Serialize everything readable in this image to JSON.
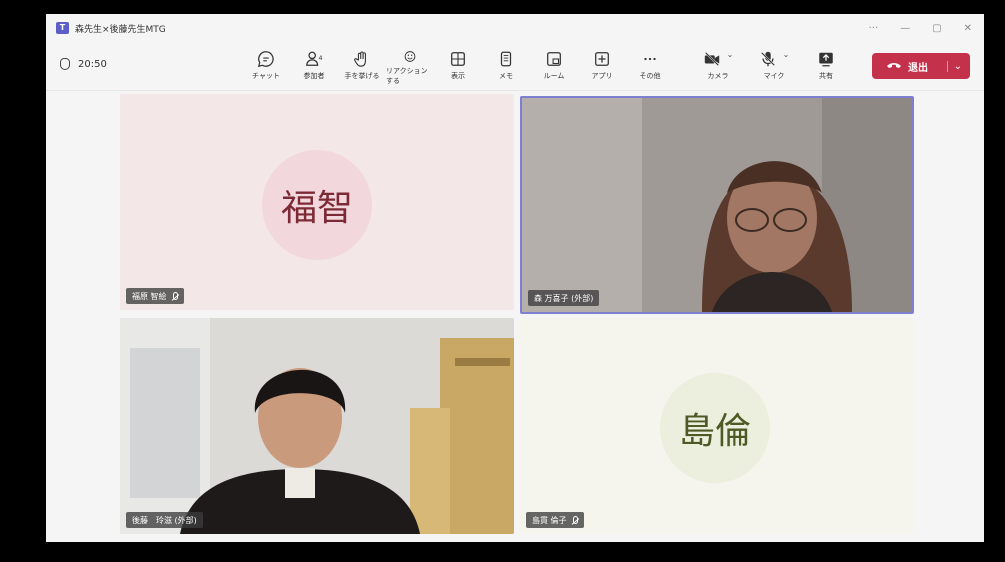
{
  "window": {
    "title": "森先生×後藤先生MTG",
    "controls": [
      "···",
      "—",
      "▢",
      "✕"
    ]
  },
  "meeting": {
    "elapsed": "20:50"
  },
  "toolbar": {
    "tools": [
      {
        "id": "chat",
        "label": "チャット"
      },
      {
        "id": "participants",
        "label": "参加者",
        "badge": "4"
      },
      {
        "id": "raise-hand",
        "label": "手を挙げる"
      },
      {
        "id": "reactions",
        "label": "リアクションする"
      },
      {
        "id": "view",
        "label": "表示"
      },
      {
        "id": "notes",
        "label": "メモ"
      },
      {
        "id": "rooms",
        "label": "ルーム"
      },
      {
        "id": "apps",
        "label": "アプリ"
      },
      {
        "id": "more",
        "label": "その他"
      }
    ],
    "camera": "カメラ",
    "mic": "マイク",
    "share": "共有",
    "leave": "退出"
  },
  "participants": [
    {
      "avatar_text": "福智",
      "name": "福原 智絵",
      "muted": true,
      "avatar_bg": "#f2d8dc"
    },
    {
      "name": "森 万喜子 (外部)",
      "video": true,
      "active_speaker": true
    },
    {
      "name": "後藤　玲滋 (外部)",
      "video": true
    },
    {
      "avatar_text": "島倫",
      "name": "島貫 倫子",
      "muted": true,
      "avatar_bg": "#ecefdd"
    }
  ]
}
